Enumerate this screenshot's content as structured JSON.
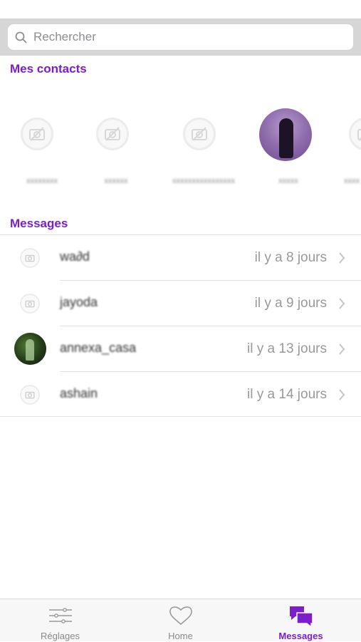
{
  "search": {
    "placeholder": "Rechercher",
    "icon": "search-icon"
  },
  "contacts": {
    "title": "Mes contacts",
    "items": [
      {
        "name": "xxxxxxxx",
        "has_photo": false
      },
      {
        "name": "xxxxxx",
        "has_photo": false
      },
      {
        "name": "xxxxxxxxxxxxxxxx",
        "has_photo": false
      },
      {
        "name": "xxxxx",
        "has_photo": true
      },
      {
        "name": "xxxx",
        "has_photo": false
      }
    ]
  },
  "messages": {
    "title": "Messages",
    "items": [
      {
        "name": "wa∂d",
        "time": "il y a 8 jours",
        "has_photo": false
      },
      {
        "name": "jayoda",
        "time": "il y a 9 jours",
        "has_photo": false
      },
      {
        "name": "annexa_casa",
        "time": "il y a 13 jours",
        "has_photo": true
      },
      {
        "name": "ashain",
        "time": "il y a 14 jours",
        "has_photo": false
      }
    ]
  },
  "tabbar": {
    "tabs": [
      {
        "label": "Réglages",
        "icon": "sliders-icon",
        "active": false
      },
      {
        "label": "Home",
        "icon": "heart-icon",
        "active": false
      },
      {
        "label": "Messages",
        "icon": "chat-bubbles-icon",
        "active": true
      }
    ]
  },
  "colors": {
    "accent": "#7a1fc9",
    "muted": "#999999",
    "search_bg": "#d6d6d6"
  }
}
